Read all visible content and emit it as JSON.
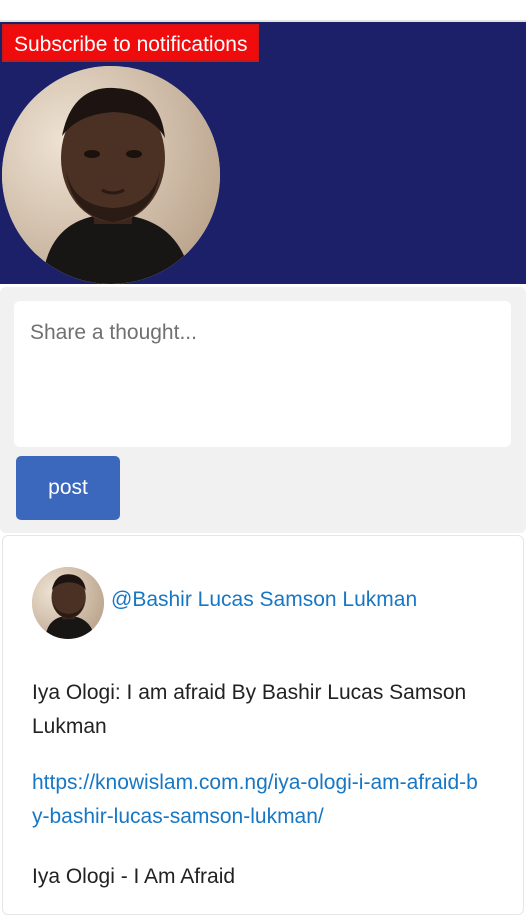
{
  "header": {
    "subscribe_label": "Subscribe to notifications"
  },
  "composer": {
    "placeholder": "Share a thought...",
    "value": "",
    "post_label": "post"
  },
  "post": {
    "author_handle": "@Bashir Lucas Samson Lukman",
    "title": "Iya Ologi: I am afraid By Bashir Lucas Samson Lukman",
    "url": "https://knowislam.com.ng/iya-ologi-i-am-afraid-by-bashir-lucas-samson-lukman/",
    "subtitle": "Iya Ologi - I Am Afraid"
  },
  "colors": {
    "banner_bg": "#1b2068",
    "subscribe_bg": "#f00c0c",
    "post_button_bg": "#3b68bd",
    "link": "#1877c5",
    "composer_bg": "#f1f1f1"
  },
  "icons": {
    "profile_avatar": "person-photo",
    "author_avatar": "person-photo"
  }
}
